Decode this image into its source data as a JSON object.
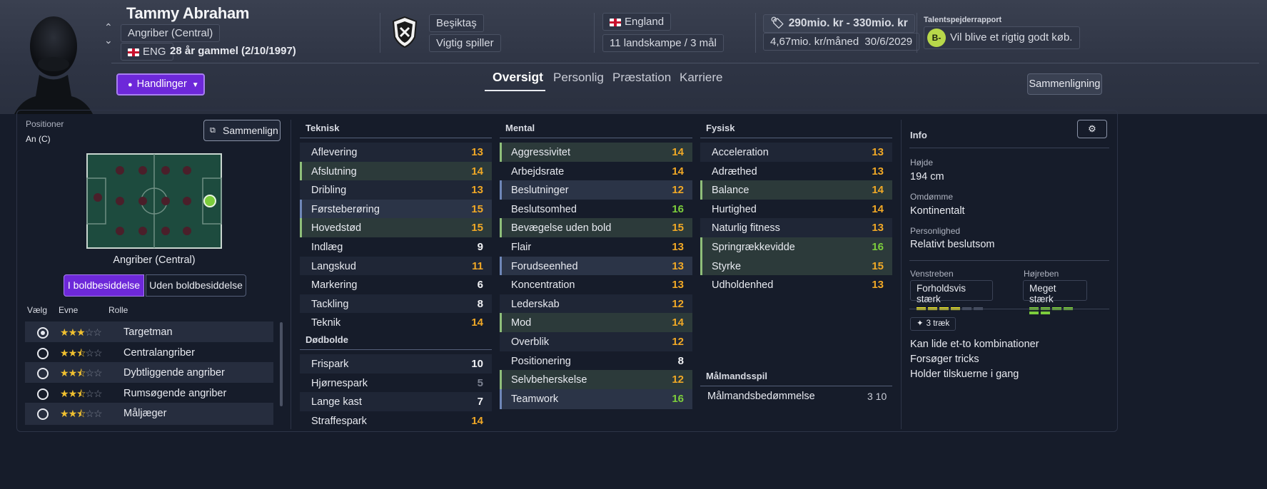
{
  "player": {
    "name": "Tammy Abraham",
    "position": "Angriber (Central)",
    "nationality_code": "ENG",
    "age_text": "28 år gammel (2/10/1997)"
  },
  "club": {
    "name": "Beşiktaş",
    "status": "Vigtig spiller"
  },
  "nation": {
    "name": "England",
    "caps": "11 landskampe / 3 mål"
  },
  "value": {
    "range": "290mio. kr - 330mio. kr",
    "wage": "4,67mio. kr/måned",
    "contract_end": "30/6/2029"
  },
  "scout": {
    "title": "Talentspejderrapport",
    "grade": "B-",
    "text": "Vil blive et rigtig godt køb."
  },
  "actions": {
    "label": "Handlinger"
  },
  "tabs": [
    "Oversigt",
    "Personlig",
    "Præstation",
    "Karriere"
  ],
  "compare_button": "Sammenligning",
  "positions": {
    "title": "Positioner",
    "value": "An (C)",
    "compare_button": "Sammenlign",
    "pitch_label": "Angriber (Central)",
    "toggle_in": "I boldbesiddelse",
    "toggle_out": "Uden boldbesiddelse",
    "col_select": "Vælg",
    "col_ability": "Evne",
    "col_role": "Rolle",
    "roles": [
      {
        "name": "Targetman",
        "stars": "3",
        "selected": true
      },
      {
        "name": "Centralangriber",
        "stars": "2.5",
        "selected": false
      },
      {
        "name": "Dybtliggende angriber",
        "stars": "2.5",
        "selected": false
      },
      {
        "name": "Rumsøgende angriber",
        "stars": "2.5",
        "selected": false
      },
      {
        "name": "Måljæger",
        "stars": "2.5",
        "selected": false
      }
    ]
  },
  "technical": {
    "title": "Teknisk",
    "attrs": [
      {
        "name": "Aflevering",
        "value": "13",
        "color": "orange",
        "hl": ""
      },
      {
        "name": "Afslutning",
        "value": "14",
        "color": "orange",
        "hl": "green"
      },
      {
        "name": "Dribling",
        "value": "13",
        "color": "orange",
        "hl": ""
      },
      {
        "name": "Førsteberøring",
        "value": "15",
        "color": "orange",
        "hl": "blue"
      },
      {
        "name": "Hovedstød",
        "value": "15",
        "color": "orange",
        "hl": "green"
      },
      {
        "name": "Indlæg",
        "value": "9",
        "color": "white",
        "hl": ""
      },
      {
        "name": "Langskud",
        "value": "11",
        "color": "orange",
        "hl": ""
      },
      {
        "name": "Markering",
        "value": "6",
        "color": "white",
        "hl": ""
      },
      {
        "name": "Tackling",
        "value": "8",
        "color": "white",
        "hl": ""
      },
      {
        "name": "Teknik",
        "value": "14",
        "color": "orange",
        "hl": ""
      }
    ]
  },
  "setpieces": {
    "title": "Dødbolde",
    "attrs": [
      {
        "name": "Frispark",
        "value": "10",
        "color": "white",
        "hl": ""
      },
      {
        "name": "Hjørnespark",
        "value": "5",
        "color": "grey",
        "hl": ""
      },
      {
        "name": "Lange kast",
        "value": "7",
        "color": "white",
        "hl": ""
      },
      {
        "name": "Straffespark",
        "value": "14",
        "color": "orange",
        "hl": ""
      }
    ]
  },
  "mental": {
    "title": "Mental",
    "attrs": [
      {
        "name": "Aggressivitet",
        "value": "14",
        "color": "orange",
        "hl": "green"
      },
      {
        "name": "Arbejdsrate",
        "value": "14",
        "color": "orange",
        "hl": ""
      },
      {
        "name": "Beslutninger",
        "value": "12",
        "color": "orange",
        "hl": "blue"
      },
      {
        "name": "Beslutsomhed",
        "value": "16",
        "color": "green",
        "hl": ""
      },
      {
        "name": "Bevægelse uden bold",
        "value": "15",
        "color": "orange",
        "hl": "green"
      },
      {
        "name": "Flair",
        "value": "13",
        "color": "orange",
        "hl": ""
      },
      {
        "name": "Forudseenhed",
        "value": "13",
        "color": "orange",
        "hl": "blue"
      },
      {
        "name": "Koncentration",
        "value": "13",
        "color": "orange",
        "hl": ""
      },
      {
        "name": "Lederskab",
        "value": "12",
        "color": "orange",
        "hl": ""
      },
      {
        "name": "Mod",
        "value": "14",
        "color": "orange",
        "hl": "green"
      },
      {
        "name": "Overblik",
        "value": "12",
        "color": "orange",
        "hl": ""
      },
      {
        "name": "Positionering",
        "value": "8",
        "color": "white",
        "hl": ""
      },
      {
        "name": "Selvbeherskelse",
        "value": "12",
        "color": "orange",
        "hl": "green"
      },
      {
        "name": "Teamwork",
        "value": "16",
        "color": "green",
        "hl": "blue"
      }
    ]
  },
  "physical": {
    "title": "Fysisk",
    "attrs": [
      {
        "name": "Acceleration",
        "value": "13",
        "color": "orange",
        "hl": ""
      },
      {
        "name": "Adræthed",
        "value": "13",
        "color": "orange",
        "hl": ""
      },
      {
        "name": "Balance",
        "value": "14",
        "color": "orange",
        "hl": "green"
      },
      {
        "name": "Hurtighed",
        "value": "14",
        "color": "orange",
        "hl": ""
      },
      {
        "name": "Naturlig fitness",
        "value": "13",
        "color": "orange",
        "hl": ""
      },
      {
        "name": "Springrækkevidde",
        "value": "16",
        "color": "green",
        "hl": "green"
      },
      {
        "name": "Styrke",
        "value": "15",
        "color": "orange",
        "hl": "green"
      },
      {
        "name": "Udholdenhed",
        "value": "13",
        "color": "orange",
        "hl": ""
      }
    ]
  },
  "goalkeeping": {
    "title": "Målmandsspil",
    "label": "Målmandsbedømmelse",
    "value": "3 10"
  },
  "info": {
    "title": "Info",
    "height_label": "Højde",
    "height": "194 cm",
    "reputation_label": "Omdømme",
    "reputation": "Kontinentalt",
    "personality_label": "Personlighed",
    "personality": "Relativt beslutsom",
    "left_foot_label": "Venstreben",
    "left_foot": "Forholdsvis stærk",
    "left_foot_level": 4,
    "right_foot_label": "Højreben",
    "right_foot": "Meget stærk",
    "right_foot_level": 6,
    "traits_badge": "3 træk",
    "traits": [
      "Kan lide et-to kombinationer",
      "Forsøger tricks",
      "Holder tilskuerne i gang"
    ]
  },
  "colors": {
    "accent": "#6d28d9",
    "orange": "#f0a826",
    "green": "#7ccd3c",
    "panel": "#161c2a"
  }
}
